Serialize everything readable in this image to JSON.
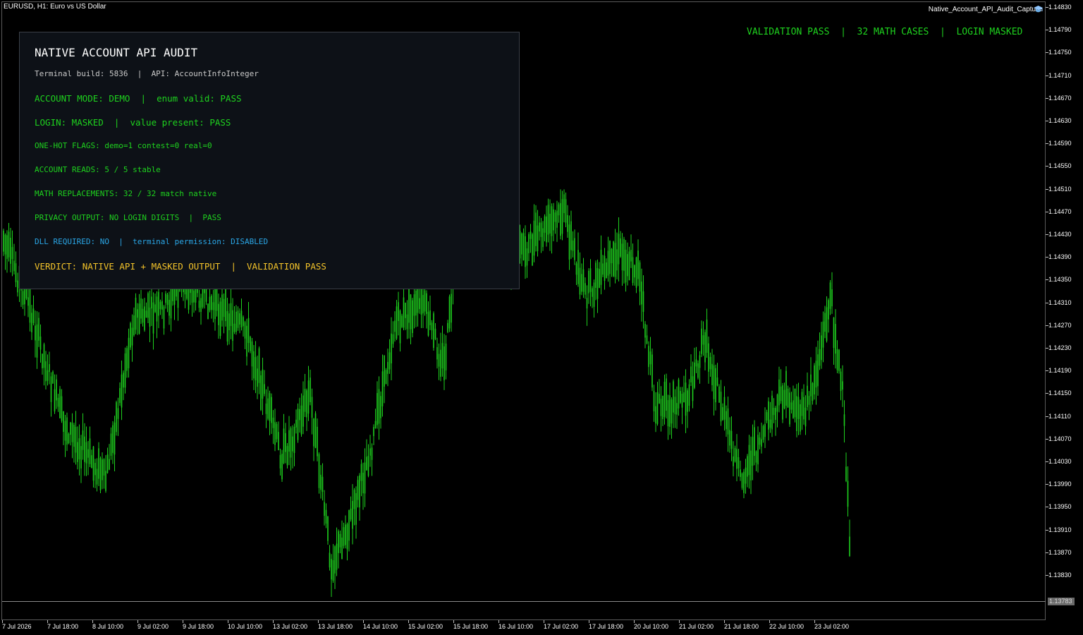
{
  "chart": {
    "symbol_label": "EURUSD, H1:  Euro vs US Dollar",
    "capture_label": "Native_Account_API_Audit_Capture",
    "capture_icon": "graduation-cap-icon",
    "candle_color": "#1ed21e",
    "background_color": "#000000",
    "current_price": "1.13783"
  },
  "status_bar": {
    "items": [
      "VALIDATION PASS",
      "32 MATH CASES",
      "LOGIN MASKED"
    ],
    "separator": "|",
    "color": "#1ed21e"
  },
  "price_axis": {
    "ticks": [
      "1.14830",
      "1.14790",
      "1.14750",
      "1.14710",
      "1.14670",
      "1.14630",
      "1.14590",
      "1.14550",
      "1.14510",
      "1.14470",
      "1.14430",
      "1.14390",
      "1.14350",
      "1.14310",
      "1.14270",
      "1.14230",
      "1.14190",
      "1.14150",
      "1.14110",
      "1.14070",
      "1.14030",
      "1.13990",
      "1.13950",
      "1.13910",
      "1.13870",
      "1.13830"
    ]
  },
  "time_axis": {
    "ticks": [
      "7 Jul 2026",
      "7 Jul 18:00",
      "8 Jul 10:00",
      "9 Jul 02:00",
      "9 Jul 18:00",
      "10 Jul 10:00",
      "13 Jul 02:00",
      "13 Jul 18:00",
      "14 Jul 10:00",
      "15 Jul 02:00",
      "15 Jul 18:00",
      "16 Jul 10:00",
      "17 Jul 02:00",
      "17 Jul 18:00",
      "20 Jul 10:00",
      "21 Jul 02:00",
      "21 Jul 18:00",
      "22 Jul 10:00",
      "23 Jul 02:00"
    ]
  },
  "panel": {
    "title": "NATIVE ACCOUNT API AUDIT",
    "subtitle": "Terminal build: 5836  |  API: AccountInfoInteger",
    "lines": {
      "account_mode": "ACCOUNT MODE: DEMO  |  enum valid: PASS",
      "login": "LOGIN: MASKED  |  value present: PASS",
      "flags": "ONE-HOT FLAGS: demo=1 contest=0 real=0",
      "reads": "ACCOUNT READS: 5 / 5 stable",
      "math": "MATH REPLACEMENTS: 32 / 32 match native",
      "privacy": "PRIVACY OUTPUT: NO LOGIN DIGITS  |  PASS",
      "dll": "DLL REQUIRED: NO  |  terminal permission: DISABLED",
      "verdict": "VERDICT: NATIVE API + MASKED OUTPUT  |  VALIDATION PASS"
    },
    "colors": {
      "green": "#1ed21e",
      "blue": "#2aa6e6",
      "gold": "#f3c32a"
    }
  }
}
